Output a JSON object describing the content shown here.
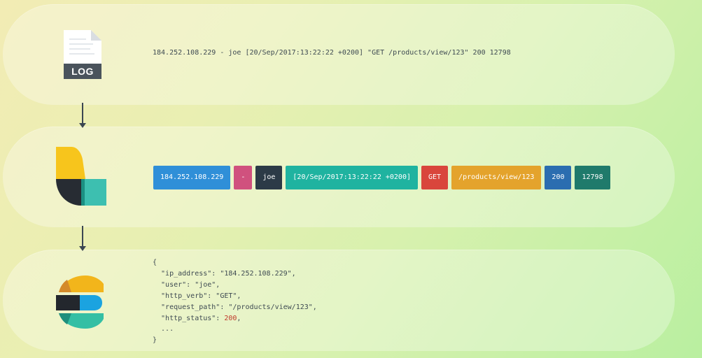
{
  "log_stage": {
    "icon_label": "LOG",
    "raw_line": "184.252.108.229 - joe [20/Sep/2017:13:22:22 +0200] \"GET /products/view/123\" 200 12798"
  },
  "parse_stage": {
    "tokens": [
      {
        "text": "184.252.108.229",
        "color": "#2f8fd8"
      },
      {
        "text": "-",
        "color": "#d0517e"
      },
      {
        "text": "joe",
        "color": "#2c3a47"
      },
      {
        "text": "[20/Sep/2017:13:22:22 +0200]",
        "color": "#1fb3a0"
      },
      {
        "text": "GET",
        "color": "#d9463c"
      },
      {
        "text": "/products/view/123",
        "color": "#e4a32c"
      },
      {
        "text": "200",
        "color": "#2b6db0"
      },
      {
        "text": "12798",
        "color": "#1f7a6b"
      }
    ]
  },
  "index_stage": {
    "json_lines": [
      {
        "text": "{"
      },
      {
        "text": "  \"ip_address\": \"184.252.108.229\","
      },
      {
        "text": "  \"user\": \"joe\","
      },
      {
        "text": "  \"http_verb\": \"GET\","
      },
      {
        "text": "  \"request_path\": \"/products/view/123\","
      },
      {
        "text": "  \"http_status\": ",
        "value": "200",
        "suffix": ","
      },
      {
        "text": "  ..."
      },
      {
        "text": "}"
      }
    ]
  },
  "colors": {
    "arrow": "#3b4651",
    "json_number": "#c0392b"
  },
  "icons": [
    "log-file-icon",
    "logstash-logo",
    "elasticsearch-logo",
    "arrow-down-icon"
  ]
}
